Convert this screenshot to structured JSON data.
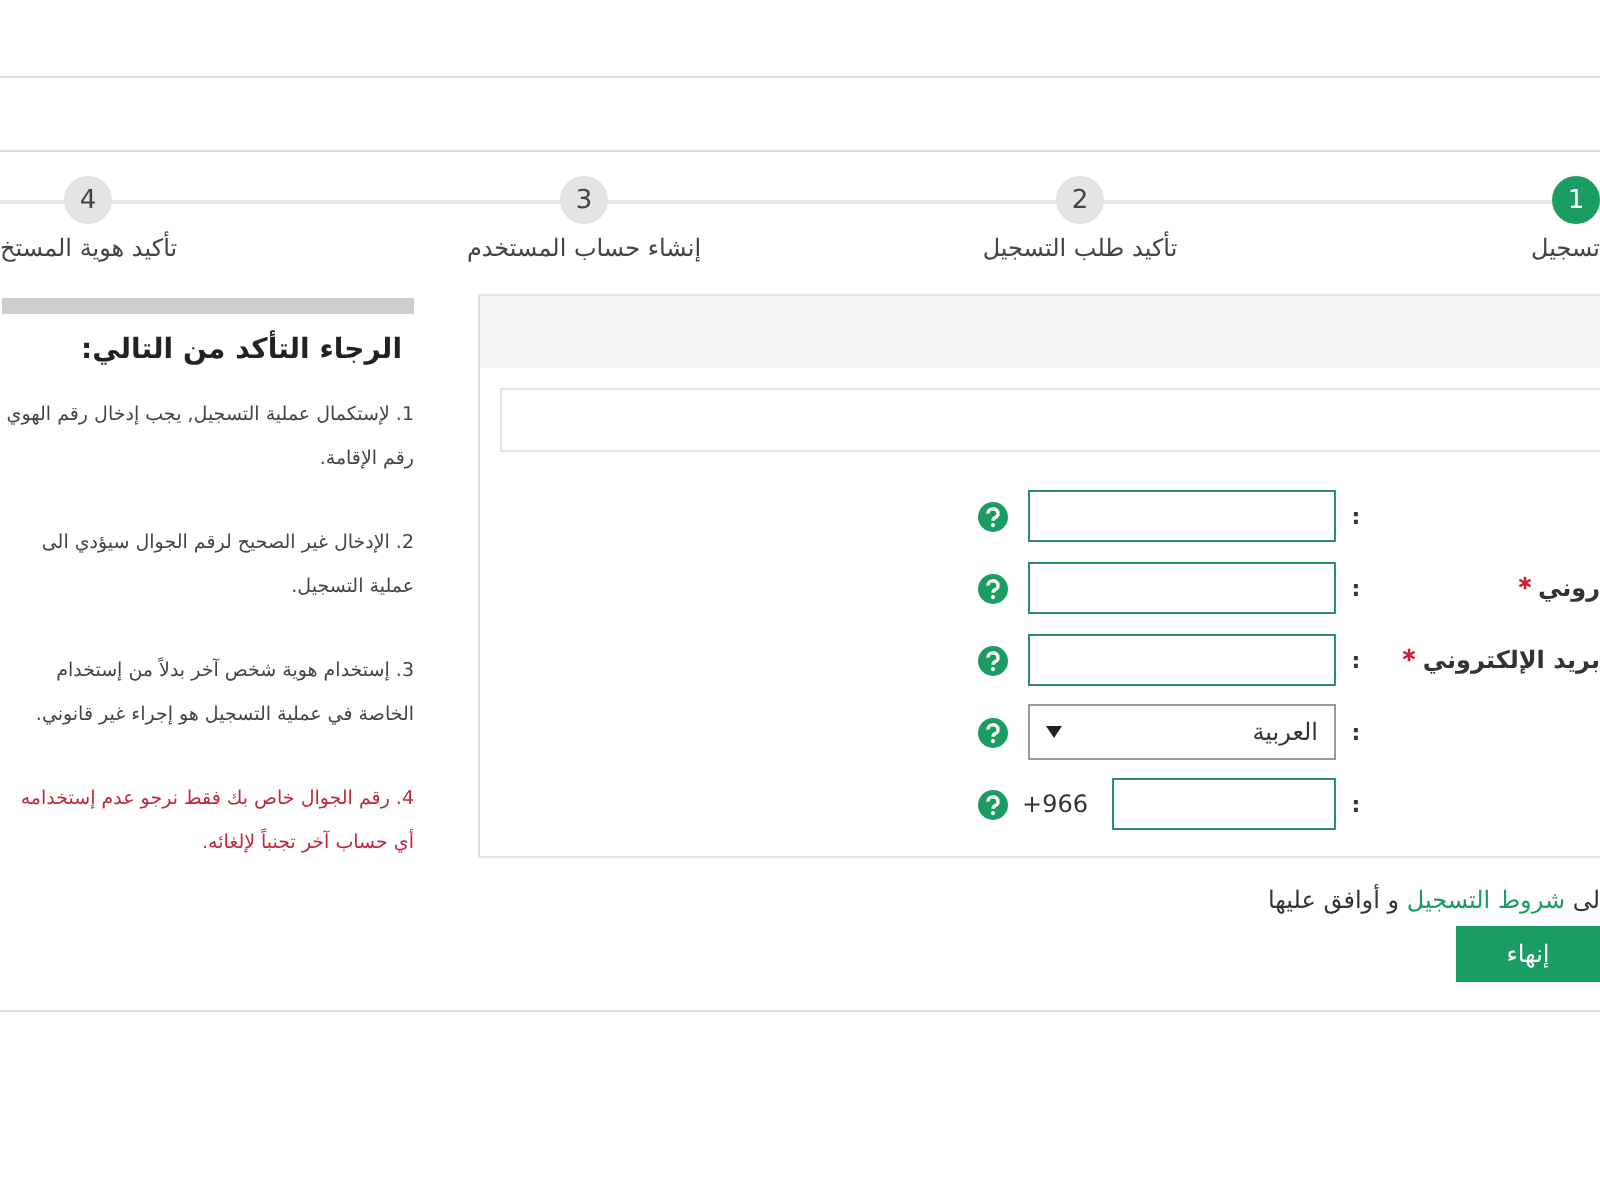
{
  "steps": [
    {
      "number": "1",
      "label": "تسجيل",
      "selected": true
    },
    {
      "number": "2",
      "label": "تأكيد طلب التسجيل",
      "selected": false
    },
    {
      "number": "3",
      "label": "إنشاء حساب المستخدم",
      "selected": false
    },
    {
      "number": "4",
      "label": "تأكيد هوية المستخ",
      "selected": false
    }
  ],
  "notes": {
    "title": "الرجاء التأكد من التالي:",
    "items": [
      {
        "lines": [
          "1. لإستكمال عملية التسجيل, يجب إدخال رقم الهوي",
          "رقم الإقامة."
        ],
        "warning": false
      },
      {
        "lines": [
          "2. الإدخال غير الصحيح لرقم الجوال سيؤدي الى",
          "عملية التسجيل."
        ],
        "warning": false
      },
      {
        "lines": [
          "3. إستخدام هوية شخص آخر بدلاً من إستخدام",
          "الخاصة في عملية التسجيل هو إجراء غير قانوني."
        ],
        "warning": false
      },
      {
        "lines": [
          "4. رقم الجوال خاص بك فقط نرجو عدم إستخدامه",
          "أي حساب آخر تجنباً لإلغائه."
        ],
        "warning": true
      }
    ]
  },
  "form": {
    "fields": [
      {
        "kind": "text",
        "colon": ":",
        "required": false
      },
      {
        "kind": "text",
        "label": "روني",
        "colon": ":",
        "required": true
      },
      {
        "kind": "text",
        "label": "بريد الإلكتروني",
        "colon": ":",
        "required": true
      },
      {
        "kind": "select",
        "colon": ":",
        "value": "العربية",
        "required": false
      },
      {
        "kind": "phone",
        "colon": ":",
        "prefix": "+966",
        "required": false
      }
    ]
  },
  "terms": {
    "before": "لى",
    "link": "شروط التسجيل",
    "after": "و أوافق عليها"
  },
  "submit": "إنهاء"
}
